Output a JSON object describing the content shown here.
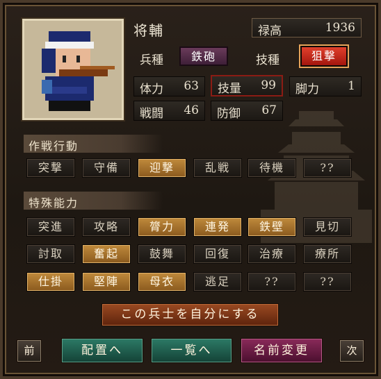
{
  "unit": {
    "name": "将輔"
  },
  "stipend": {
    "label": "禄高",
    "value": "1936"
  },
  "troop_type": {
    "label": "兵種",
    "value": "鉄砲"
  },
  "skill_type": {
    "label": "技種",
    "value": "狙撃"
  },
  "stats": {
    "hp": {
      "label": "体力",
      "value": "63"
    },
    "skill": {
      "label": "技量",
      "value": "99"
    },
    "speed": {
      "label": "脚力",
      "value": "1"
    },
    "combat": {
      "label": "戦闘",
      "value": "46"
    },
    "defense": {
      "label": "防御",
      "value": "67"
    }
  },
  "tactics": {
    "header": "作戦行動",
    "items": [
      "突撃",
      "守備",
      "迎撃",
      "乱戦",
      "待機",
      "??"
    ]
  },
  "abilities": {
    "header": "特殊能力",
    "rows": [
      [
        "突進",
        "攻略",
        "膂力",
        "連発",
        "鉄壁",
        "見切"
      ],
      [
        "討取",
        "奮起",
        "鼓舞",
        "回復",
        "治療",
        "療所"
      ],
      [
        "仕掛",
        "堅陣",
        "母衣",
        "逃足",
        "??",
        "??"
      ]
    ]
  },
  "actions": {
    "make_mine": "この兵士を自分にする",
    "prev": "前",
    "deploy": "配置へ",
    "list": "一覧へ",
    "rename": "名前変更",
    "next": "次"
  },
  "colors": {
    "selected": "#c08a3c",
    "accent_red": "#8b1c14",
    "teal": "#1f5a4c",
    "magenta": "#6a1f44"
  }
}
